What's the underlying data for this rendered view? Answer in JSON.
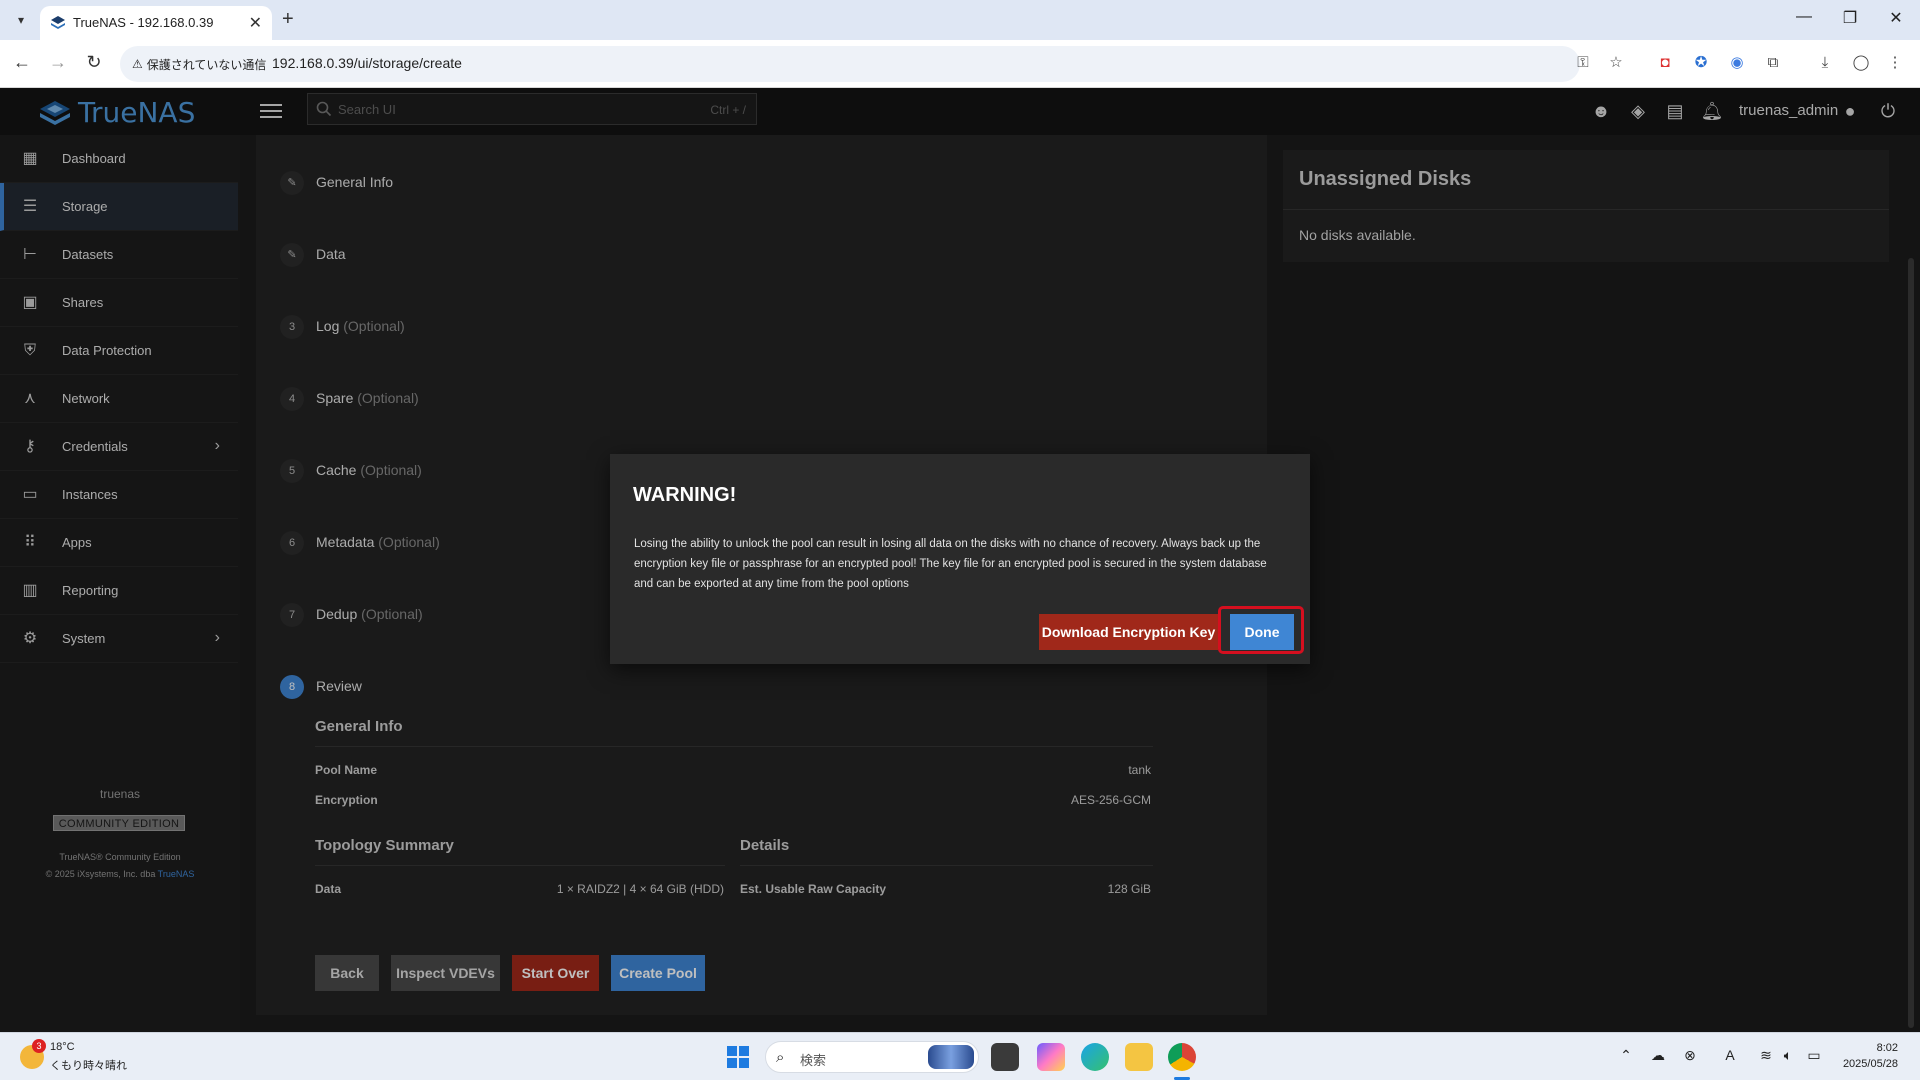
{
  "browser": {
    "tab_title": "TrueNAS - 192.168.0.39",
    "security_label": "保護されていない通信",
    "url": "192.168.0.39/ui/storage/create"
  },
  "header": {
    "logo_text": "TrueNAS",
    "search_placeholder": "Search UI",
    "search_shortcut": "Ctrl + /",
    "username": "truenas_admin"
  },
  "sidebar": {
    "items": [
      {
        "label": "Dashboard",
        "icon": "dashboard-icon"
      },
      {
        "label": "Storage",
        "icon": "storage-icon"
      },
      {
        "label": "Datasets",
        "icon": "datasets-icon"
      },
      {
        "label": "Shares",
        "icon": "shares-icon"
      },
      {
        "label": "Data Protection",
        "icon": "shield-icon"
      },
      {
        "label": "Network",
        "icon": "network-icon"
      },
      {
        "label": "Credentials",
        "icon": "key-icon"
      },
      {
        "label": "Instances",
        "icon": "laptop-icon"
      },
      {
        "label": "Apps",
        "icon": "apps-grid-icon"
      },
      {
        "label": "Reporting",
        "icon": "bar-chart-icon"
      },
      {
        "label": "System",
        "icon": "gear-icon"
      }
    ],
    "active_item": "Storage",
    "hostname": "truenas",
    "edition": "COMMUNITY EDITION",
    "copyright_line1": "TrueNAS® Community Edition",
    "copyright_line2": "© 2025 iXsystems, Inc. dba",
    "copyright_link": "TrueNAS"
  },
  "wizard": {
    "steps": [
      {
        "badge": "",
        "label": "General Info",
        "optional": ""
      },
      {
        "badge": "",
        "label": "Data",
        "optional": ""
      },
      {
        "badge": "3",
        "label": "Log",
        "optional": "(Optional)"
      },
      {
        "badge": "4",
        "label": "Spare",
        "optional": "(Optional)"
      },
      {
        "badge": "5",
        "label": "Cache",
        "optional": "(Optional)"
      },
      {
        "badge": "6",
        "label": "Metadata",
        "optional": "(Optional)"
      },
      {
        "badge": "7",
        "label": "Dedup",
        "optional": "(Optional)"
      },
      {
        "badge": "8",
        "label": "Review",
        "optional": ""
      }
    ],
    "review": {
      "general_info_title": "General Info",
      "pool_name_label": "Pool Name",
      "pool_name_value": "tank",
      "encryption_label": "Encryption",
      "encryption_value": "AES-256-GCM",
      "topology_title": "Topology Summary",
      "data_label": "Data",
      "data_value": "1 × RAIDZ2 | 4 × 64 GiB (HDD)",
      "details_title": "Details",
      "capacity_label": "Est. Usable Raw Capacity",
      "capacity_value": "128 GiB"
    },
    "buttons": {
      "back": "Back",
      "inspect": "Inspect VDEVs",
      "start_over": "Start Over",
      "create": "Create Pool"
    }
  },
  "right_panel": {
    "title": "Unassigned Disks",
    "empty_text": "No disks available."
  },
  "dialog": {
    "title": "WARNING!",
    "message": "Losing the ability to unlock the pool can result in losing all data on the disks with no chance of recovery. Always back up the encryption key file or passphrase for an encrypted pool! The key file for an encrypted pool is secured in the system database and can be exported at any time from the pool options",
    "download_label": "Download Encryption Key",
    "done_label": "Done"
  },
  "taskbar": {
    "weather_badge": "3",
    "weather_temp": "18°C",
    "weather_desc": "くもり時々晴れ",
    "search_placeholder": "検索",
    "time": "8:02",
    "date": "2025/05/28"
  },
  "colors": {
    "accent_blue": "#3f86d4",
    "danger_red": "#a0281a",
    "highlight_red": "#d50f1f"
  }
}
